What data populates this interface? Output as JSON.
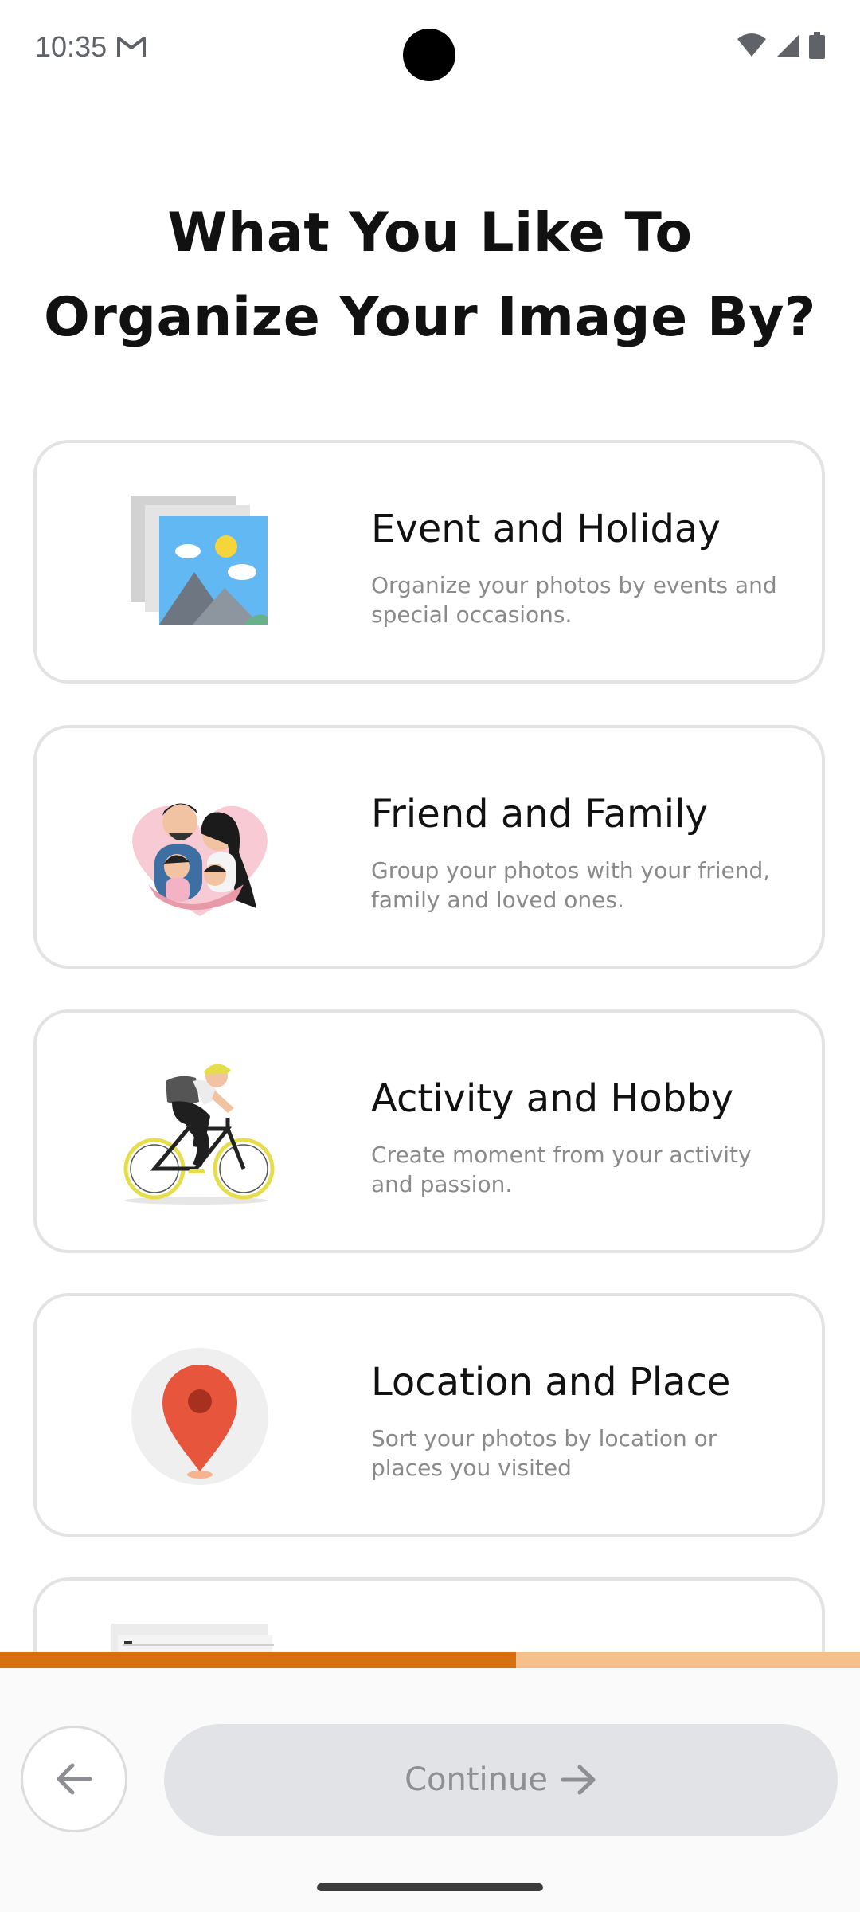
{
  "status_bar": {
    "time": "10:35"
  },
  "heading": {
    "line1": "What You Like To",
    "line2": "Organize Your Image By?"
  },
  "options": [
    {
      "title": "Event and Holiday",
      "description": "Organize your photos by events and special occasions.",
      "icon": "photo-stack-icon"
    },
    {
      "title": "Friend and Family",
      "description": "Group your photos with your friend, family and loved ones.",
      "icon": "family-illustration"
    },
    {
      "title": "Activity and Hobby",
      "description": "Create moment from your activity and passion.",
      "icon": "cyclist-illustration"
    },
    {
      "title": "Location and Place",
      "description": "Sort your photos by location or places you visited",
      "icon": "location-pin-icon"
    }
  ],
  "progress": {
    "value": 0.6
  },
  "footer": {
    "continue_label": "Continue"
  },
  "colors": {
    "accent": "#d9700f",
    "accent_light": "#f5c08c",
    "button_disabled": "#e2e3e6"
  }
}
